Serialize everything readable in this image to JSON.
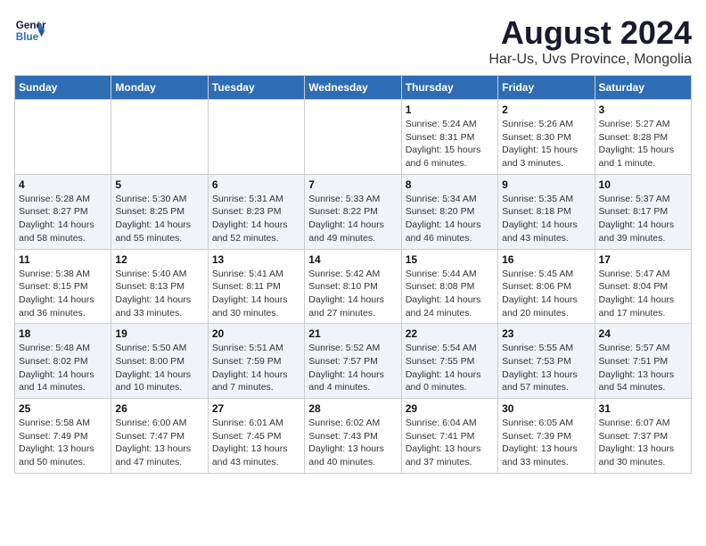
{
  "header": {
    "logo_line1": "General",
    "logo_line2": "Blue",
    "month_year": "August 2024",
    "location": "Har-Us, Uvs Province, Mongolia"
  },
  "weekdays": [
    "Sunday",
    "Monday",
    "Tuesday",
    "Wednesday",
    "Thursday",
    "Friday",
    "Saturday"
  ],
  "weeks": [
    [
      {
        "day": "",
        "info": ""
      },
      {
        "day": "",
        "info": ""
      },
      {
        "day": "",
        "info": ""
      },
      {
        "day": "",
        "info": ""
      },
      {
        "day": "1",
        "info": "Sunrise: 5:24 AM\nSunset: 8:31 PM\nDaylight: 15 hours\nand 6 minutes."
      },
      {
        "day": "2",
        "info": "Sunrise: 5:26 AM\nSunset: 8:30 PM\nDaylight: 15 hours\nand 3 minutes."
      },
      {
        "day": "3",
        "info": "Sunrise: 5:27 AM\nSunset: 8:28 PM\nDaylight: 15 hours\nand 1 minute."
      }
    ],
    [
      {
        "day": "4",
        "info": "Sunrise: 5:28 AM\nSunset: 8:27 PM\nDaylight: 14 hours\nand 58 minutes."
      },
      {
        "day": "5",
        "info": "Sunrise: 5:30 AM\nSunset: 8:25 PM\nDaylight: 14 hours\nand 55 minutes."
      },
      {
        "day": "6",
        "info": "Sunrise: 5:31 AM\nSunset: 8:23 PM\nDaylight: 14 hours\nand 52 minutes."
      },
      {
        "day": "7",
        "info": "Sunrise: 5:33 AM\nSunset: 8:22 PM\nDaylight: 14 hours\nand 49 minutes."
      },
      {
        "day": "8",
        "info": "Sunrise: 5:34 AM\nSunset: 8:20 PM\nDaylight: 14 hours\nand 46 minutes."
      },
      {
        "day": "9",
        "info": "Sunrise: 5:35 AM\nSunset: 8:18 PM\nDaylight: 14 hours\nand 43 minutes."
      },
      {
        "day": "10",
        "info": "Sunrise: 5:37 AM\nSunset: 8:17 PM\nDaylight: 14 hours\nand 39 minutes."
      }
    ],
    [
      {
        "day": "11",
        "info": "Sunrise: 5:38 AM\nSunset: 8:15 PM\nDaylight: 14 hours\nand 36 minutes."
      },
      {
        "day": "12",
        "info": "Sunrise: 5:40 AM\nSunset: 8:13 PM\nDaylight: 14 hours\nand 33 minutes."
      },
      {
        "day": "13",
        "info": "Sunrise: 5:41 AM\nSunset: 8:11 PM\nDaylight: 14 hours\nand 30 minutes."
      },
      {
        "day": "14",
        "info": "Sunrise: 5:42 AM\nSunset: 8:10 PM\nDaylight: 14 hours\nand 27 minutes."
      },
      {
        "day": "15",
        "info": "Sunrise: 5:44 AM\nSunset: 8:08 PM\nDaylight: 14 hours\nand 24 minutes."
      },
      {
        "day": "16",
        "info": "Sunrise: 5:45 AM\nSunset: 8:06 PM\nDaylight: 14 hours\nand 20 minutes."
      },
      {
        "day": "17",
        "info": "Sunrise: 5:47 AM\nSunset: 8:04 PM\nDaylight: 14 hours\nand 17 minutes."
      }
    ],
    [
      {
        "day": "18",
        "info": "Sunrise: 5:48 AM\nSunset: 8:02 PM\nDaylight: 14 hours\nand 14 minutes."
      },
      {
        "day": "19",
        "info": "Sunrise: 5:50 AM\nSunset: 8:00 PM\nDaylight: 14 hours\nand 10 minutes."
      },
      {
        "day": "20",
        "info": "Sunrise: 5:51 AM\nSunset: 7:59 PM\nDaylight: 14 hours\nand 7 minutes."
      },
      {
        "day": "21",
        "info": "Sunrise: 5:52 AM\nSunset: 7:57 PM\nDaylight: 14 hours\nand 4 minutes."
      },
      {
        "day": "22",
        "info": "Sunrise: 5:54 AM\nSunset: 7:55 PM\nDaylight: 14 hours\nand 0 minutes."
      },
      {
        "day": "23",
        "info": "Sunrise: 5:55 AM\nSunset: 7:53 PM\nDaylight: 13 hours\nand 57 minutes."
      },
      {
        "day": "24",
        "info": "Sunrise: 5:57 AM\nSunset: 7:51 PM\nDaylight: 13 hours\nand 54 minutes."
      }
    ],
    [
      {
        "day": "25",
        "info": "Sunrise: 5:58 AM\nSunset: 7:49 PM\nDaylight: 13 hours\nand 50 minutes."
      },
      {
        "day": "26",
        "info": "Sunrise: 6:00 AM\nSunset: 7:47 PM\nDaylight: 13 hours\nand 47 minutes."
      },
      {
        "day": "27",
        "info": "Sunrise: 6:01 AM\nSunset: 7:45 PM\nDaylight: 13 hours\nand 43 minutes."
      },
      {
        "day": "28",
        "info": "Sunrise: 6:02 AM\nSunset: 7:43 PM\nDaylight: 13 hours\nand 40 minutes."
      },
      {
        "day": "29",
        "info": "Sunrise: 6:04 AM\nSunset: 7:41 PM\nDaylight: 13 hours\nand 37 minutes."
      },
      {
        "day": "30",
        "info": "Sunrise: 6:05 AM\nSunset: 7:39 PM\nDaylight: 13 hours\nand 33 minutes."
      },
      {
        "day": "31",
        "info": "Sunrise: 6:07 AM\nSunset: 7:37 PM\nDaylight: 13 hours\nand 30 minutes."
      }
    ]
  ]
}
